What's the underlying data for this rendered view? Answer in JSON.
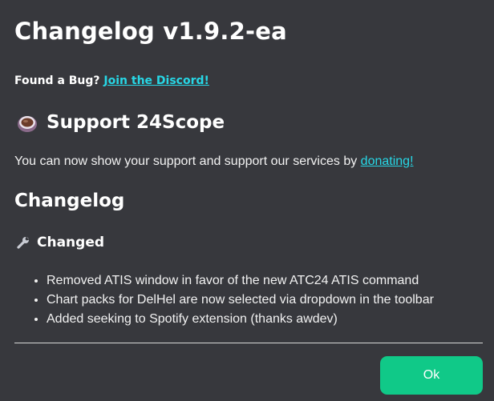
{
  "dialog": {
    "title": "Changelog v1.9.2-ea",
    "bug_prefix": "Found a Bug?",
    "bug_link": "Join the Discord!",
    "support": {
      "icon": "coffee-cup-icon",
      "heading": "Support 24Scope",
      "text_prefix": "You can now show your support and support our services by",
      "link": "donating!"
    },
    "changelog": {
      "heading": "Changelog",
      "section_icon": "wrench-icon",
      "section_label": "Changed",
      "items": [
        "Removed ATIS window in favor of the new ATC24 ATIS command",
        "Chart packs for DelHel are now selected via dropdown in the toolbar",
        "Added seeking to Spotify extension (thanks awdev)"
      ]
    },
    "ok_label": "Ok"
  },
  "colors": {
    "background": "#37383d",
    "link": "#27d7e6",
    "ok_button": "#10c988"
  }
}
